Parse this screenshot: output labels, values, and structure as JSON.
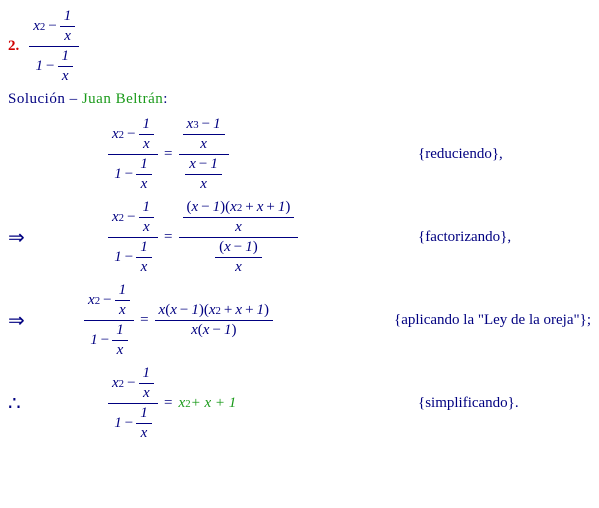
{
  "problem": {
    "number": "2."
  },
  "solution_line": {
    "label": "Solución",
    "dash": " – ",
    "author": "Juan Beltrán",
    "colon": ":"
  },
  "leads": {
    "implies": "⇒",
    "therefore": "∴"
  },
  "math": {
    "x": "x",
    "x2": "2",
    "x3": "3",
    "one": "1",
    "minus": "−",
    "plus": "+",
    "eq": "="
  },
  "notes": {
    "step1": "{reduciendo},",
    "step2": "{factorizando},",
    "step3": "{aplicando la \"Ley de la oreja\"};",
    "step4": "{simplificando}."
  },
  "result": "x",
  "result_sq": "2",
  "result_tail": " + x + 1"
}
